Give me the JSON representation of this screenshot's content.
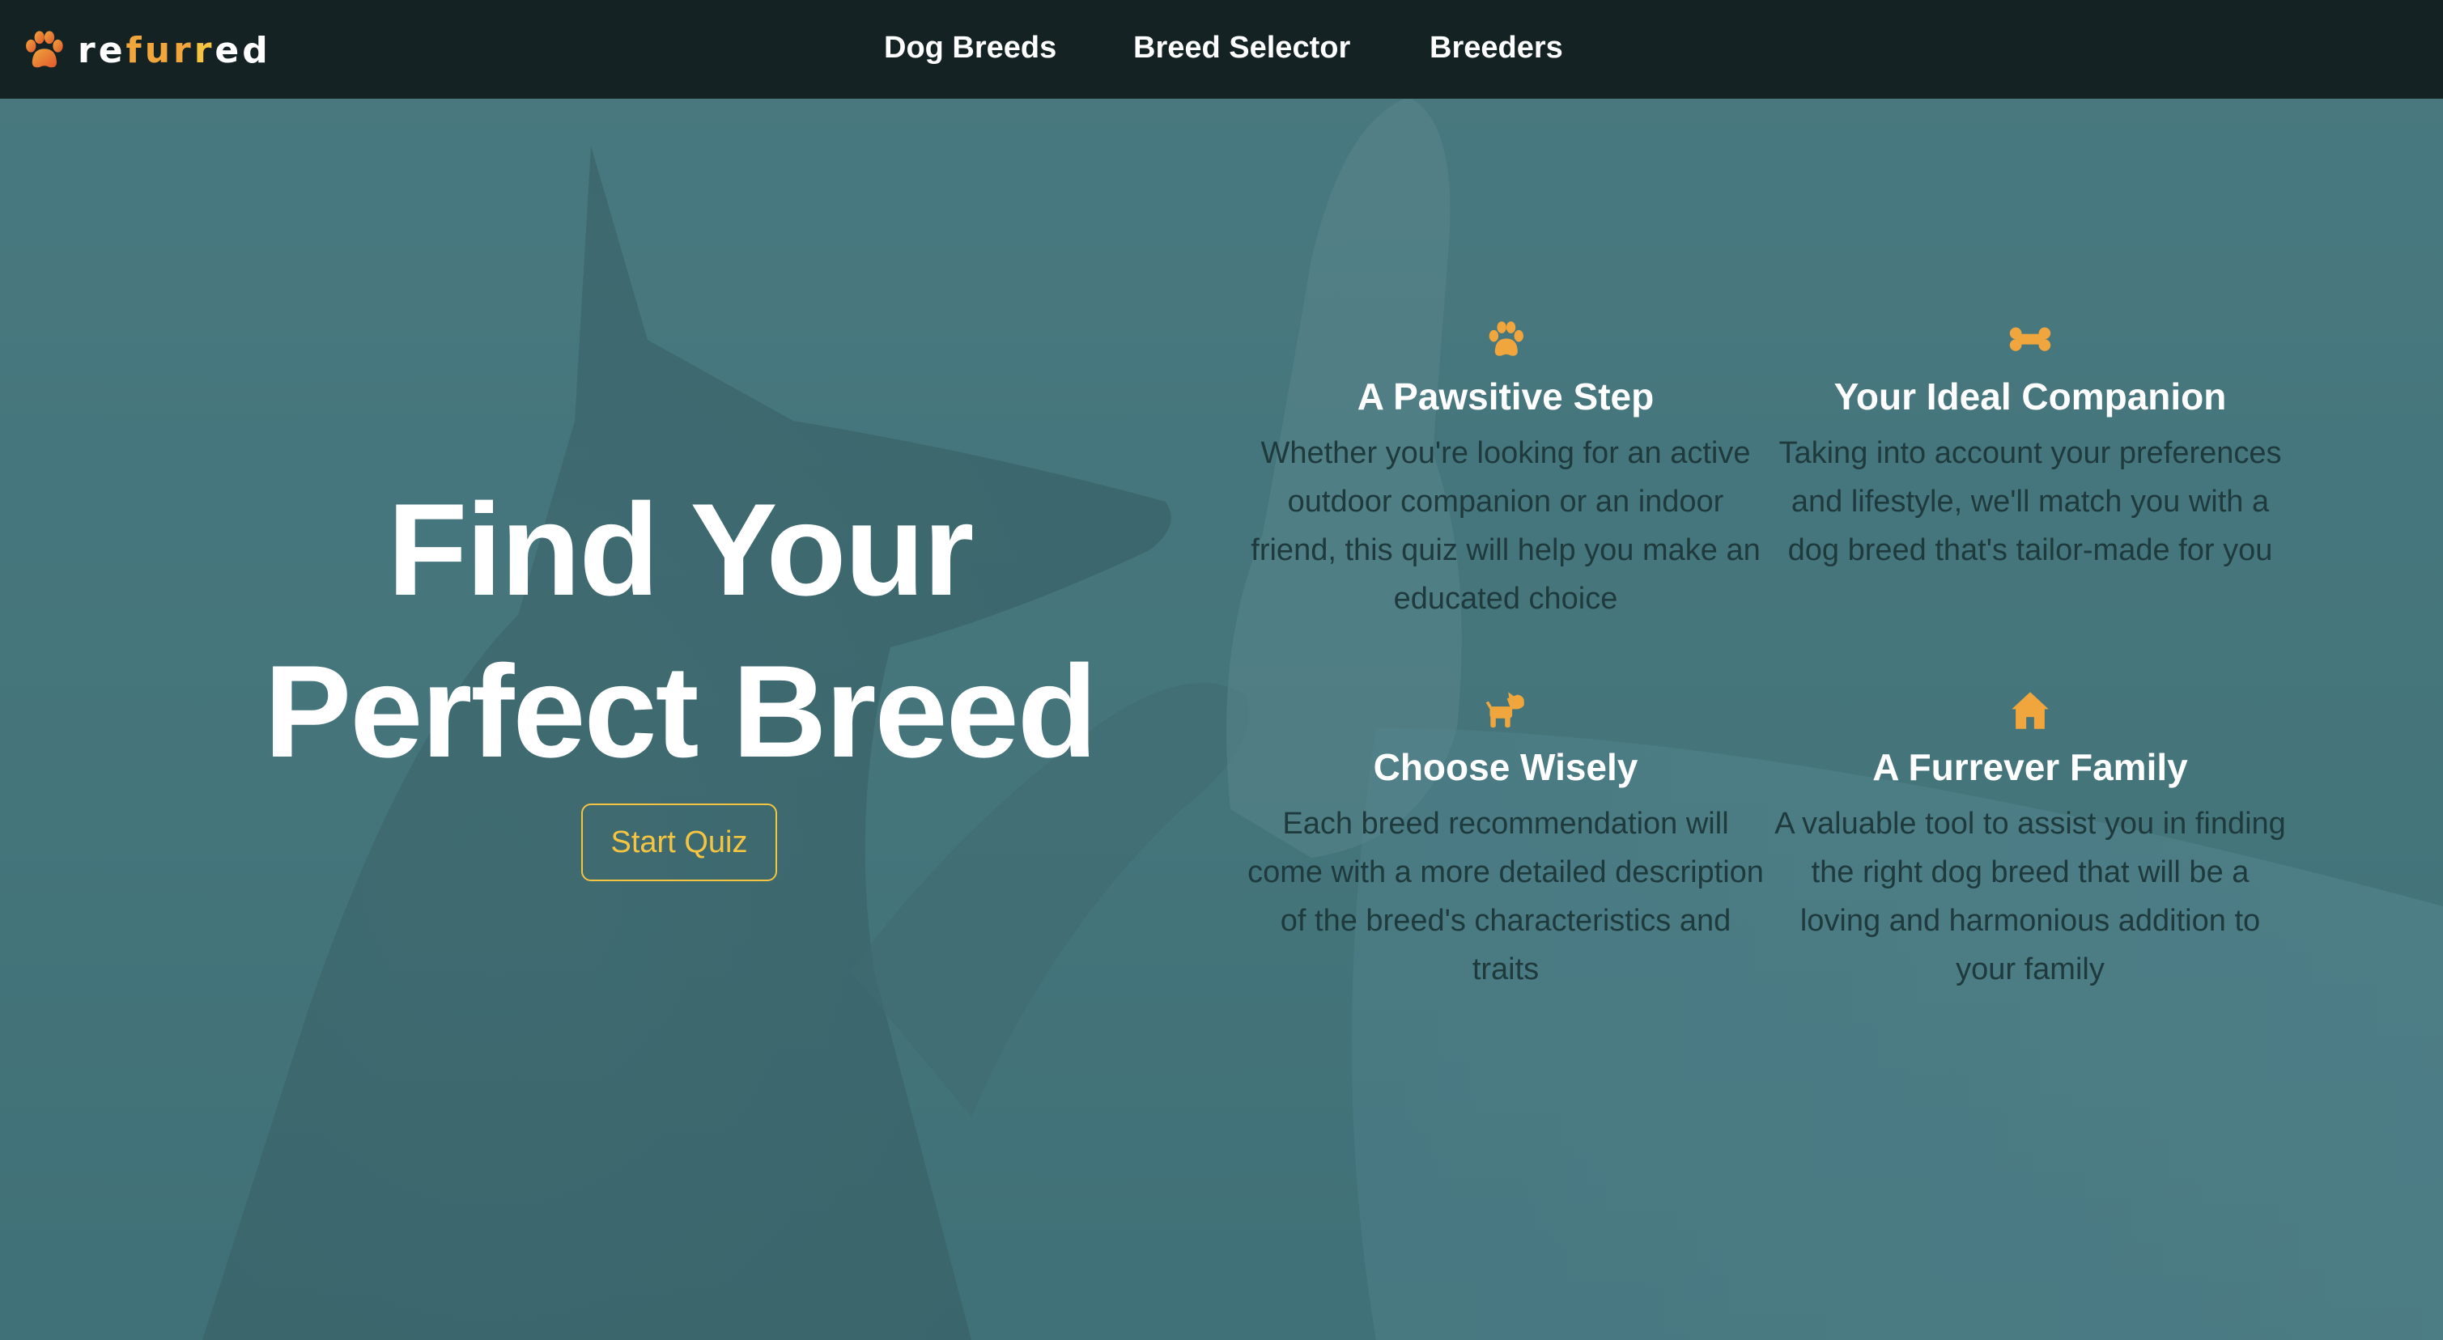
{
  "nav": {
    "logo_text_parts": [
      "re",
      "fur",
      "r",
      "ed"
    ],
    "links": [
      "Dog Breeds",
      "Breed Selector",
      "Breeders"
    ]
  },
  "hero": {
    "title_line1": "Find Your",
    "title_line2": "Perfect Breed",
    "cta_label": "Start Quiz"
  },
  "features": [
    {
      "icon": "paw-icon",
      "title": "A Pawsitive Step",
      "body": "Whether you're looking for an active outdoor companion or an indoor friend, this quiz will help you make an educated choice"
    },
    {
      "icon": "bone-icon",
      "title": "Your Ideal Companion",
      "body": "Taking into account your preferences and lifestyle, we'll match you with a dog breed that's tailor-made for you"
    },
    {
      "icon": "dog-icon",
      "title": "Choose Wisely",
      "body": "Each breed recommendation will come with a more detailed description of the breed's characteristics and traits"
    },
    {
      "icon": "house-icon",
      "title": "A Furrever Family",
      "body": "A valuable tool to assist you in finding the right dog breed that will be a loving and harmonious addition to your family"
    }
  ],
  "colors": {
    "navbar_bg": "#152224",
    "accent_orange": "#f0a63c",
    "cta_yellow": "#f5c542",
    "hero_tint": "#457479",
    "body_text": "#1e3a3d"
  }
}
